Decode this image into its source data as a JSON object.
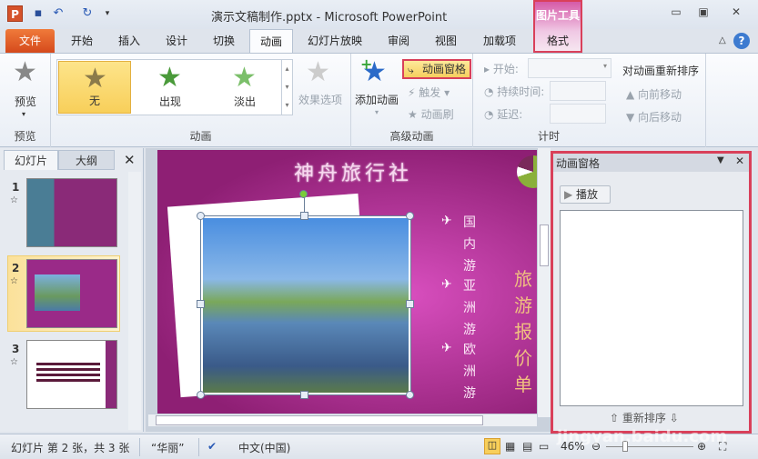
{
  "window": {
    "title": "演示文稿制作.pptx - Microsoft PowerPoint",
    "context_group": "图片工具",
    "app_icon": "P"
  },
  "tabs": [
    "文件",
    "开始",
    "插入",
    "设计",
    "切换",
    "动画",
    "幻灯片放映",
    "审阅",
    "视图",
    "加载项",
    "格式"
  ],
  "active_tab": "动画",
  "ribbon": {
    "preview": {
      "button": "预览",
      "group": "预览"
    },
    "animation": {
      "items": [
        "无",
        "出现",
        "淡出"
      ],
      "selected": "无",
      "effect_options": "效果选项",
      "group": "动画"
    },
    "advanced": {
      "add": "添加动画",
      "pane": "动画窗格",
      "trigger": "触发",
      "painter": "动画刷",
      "group": "高级动画"
    },
    "timing": {
      "start": "开始:",
      "duration": "持续时间:",
      "delay": "延迟:",
      "reorder": "对动画重新排序",
      "move_earlier": "向前移动",
      "move_later": "向后移动",
      "group": "计时"
    }
  },
  "left_panel": {
    "tabs": [
      "幻灯片",
      "大纲"
    ],
    "slides": [
      "1",
      "2",
      "3"
    ],
    "selected": "2"
  },
  "slide": {
    "title": "神舟旅行社",
    "bullets": [
      "国内游",
      "亚洲游",
      "欧洲游"
    ],
    "side_text": "旅游报价单"
  },
  "anim_pane": {
    "title": "动画窗格",
    "play": "播放",
    "reorder": "重新排序"
  },
  "status": {
    "slide_info": "幻灯片 第 2 张，共 3 张",
    "theme": "“华丽”",
    "language": "中文(中国)",
    "zoom": "46%",
    "zoom_fraction": 0.46
  },
  "watermark": "jingyan.baidu.com",
  "colors": {
    "highlight": "#d9405a",
    "file_tab": "#e0602a",
    "selected": "#f8cf5a"
  }
}
